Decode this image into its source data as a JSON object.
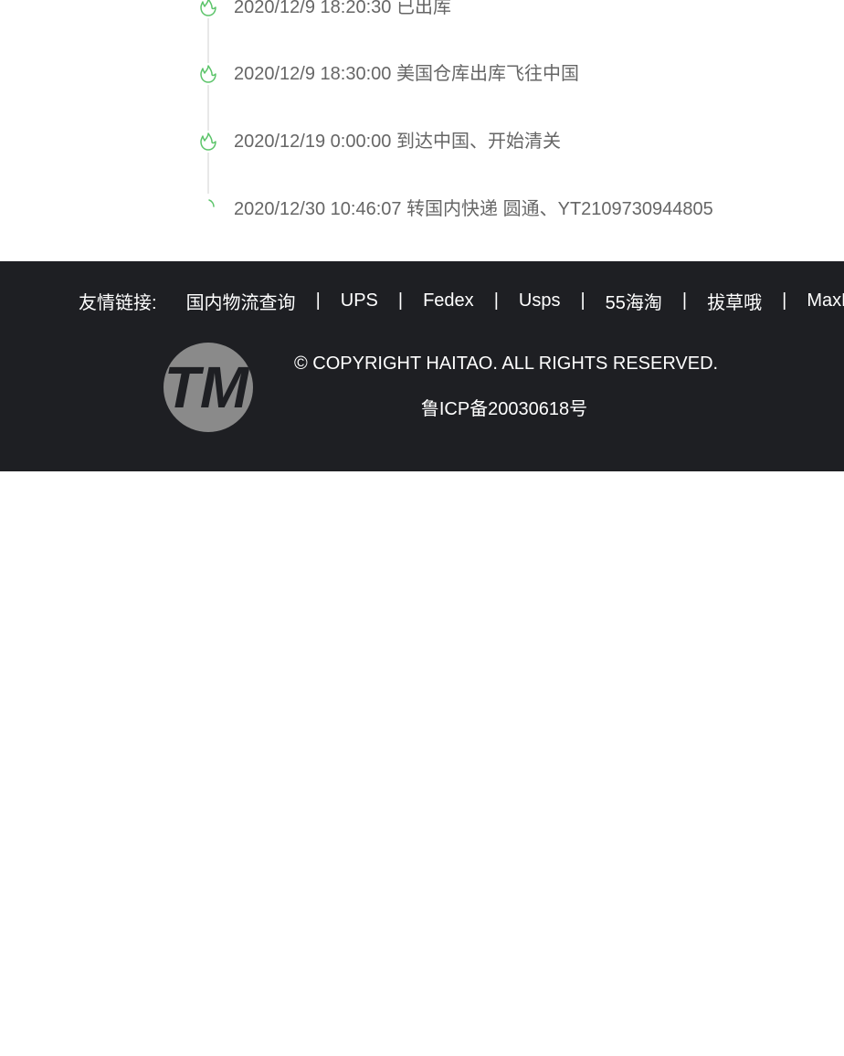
{
  "timeline": {
    "events": [
      {
        "text": "2020/12/9 18:20:30 已出库",
        "icon": "flame-icon"
      },
      {
        "text": "2020/12/9 18:30:00 美国仓库出库飞往中国",
        "icon": "flame-icon"
      },
      {
        "text": "2020/12/19 0:00:00 到达中国、开始清关",
        "icon": "flame-icon"
      },
      {
        "text": "2020/12/30 10:46:07 转国内快递 圆通、YT2109730944805",
        "icon": "loading-icon"
      }
    ],
    "accent_color": "#5cc46a"
  },
  "footer": {
    "links_title": "友情链接:",
    "links": [
      "国内物流查询",
      "UPS",
      "Fedex",
      "Usps",
      "55海淘",
      "拔草哦",
      "MaxRe"
    ],
    "separator": "|",
    "logo_text": "TM",
    "copyright": "© COPYRIGHT HAITAO. ALL RIGHTS RESERVED.",
    "icp": "鲁ICP备20030618号",
    "background_color": "#1e1f23"
  }
}
